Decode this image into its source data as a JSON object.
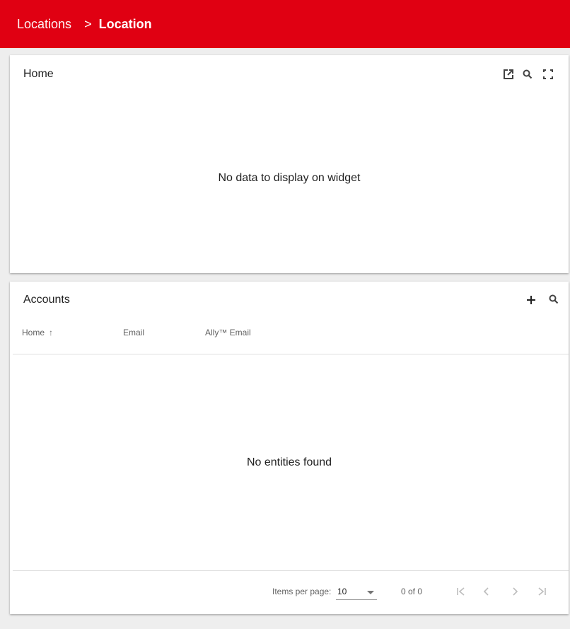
{
  "breadcrumb": {
    "parent": "Locations",
    "separator": ">",
    "current": "Location"
  },
  "home_widget": {
    "title": "Home",
    "empty_message": "No data to display on widget",
    "icons": [
      "open-in-new-icon",
      "search-icon",
      "fullscreen-icon"
    ]
  },
  "accounts_widget": {
    "title": "Accounts",
    "icons": [
      "add-icon",
      "search-icon"
    ],
    "columns": [
      {
        "label": "Home",
        "sort": "ascending"
      },
      {
        "label": "Email"
      },
      {
        "label": "Ally™ Email"
      }
    ],
    "sort_arrow": "↑",
    "empty_message": "No entities found",
    "paginator": {
      "items_per_page_label": "Items per page:",
      "items_per_page_value": "10",
      "range_label": "0 of 0"
    }
  },
  "colors": {
    "header_red": "#e00012",
    "background": "#eeeeee",
    "card": "#ffffff",
    "disabled_icon": "#bdbdbd"
  }
}
